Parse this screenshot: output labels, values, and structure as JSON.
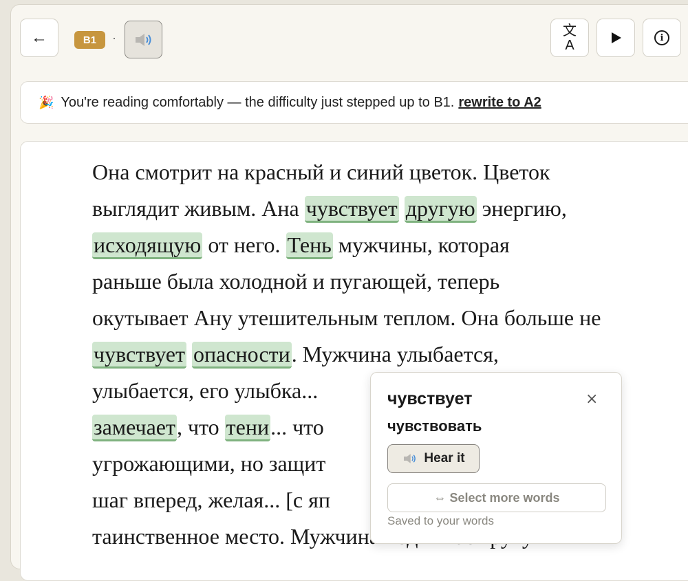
{
  "toolbar": {
    "back_label": "←",
    "level": "B1",
    "separator": "·",
    "translate_top": "文",
    "translate_bottom": "A",
    "play_label": "▶",
    "info_label": "i"
  },
  "notice": {
    "emoji": "🎉",
    "text": "You're reading comfortably — the difficulty just stepped up to B1.",
    "link": "rewrite to A2"
  },
  "reader": {
    "lines": [
      [
        {
          "t": "Она смотрит на красный и синий цветок. Цветок"
        }
      ],
      [
        {
          "t": "выглядит живым. Ана "
        },
        {
          "t": "чувствует",
          "h": true
        },
        {
          "t": " "
        },
        {
          "t": "другую",
          "h": true
        },
        {
          "t": " энергию,"
        }
      ],
      [
        {
          "t": "исходящую",
          "h": true
        },
        {
          "t": " от него. "
        },
        {
          "t": "Тень",
          "h": true
        },
        {
          "t": " мужчины, которая"
        }
      ],
      [
        {
          "t": "раньше была холодной и пугающей, теперь"
        }
      ],
      [
        {
          "t": "окутывает Ану утешительным теплом. Она больше не"
        }
      ],
      [
        {
          "t": "чувствует",
          "h": true
        },
        {
          "t": " "
        },
        {
          "t": "опасности",
          "h": true
        },
        {
          "t": ". Мужчина улыбается,"
        }
      ],
      [
        {
          "t": "улыбается, его улыбка... "
        }
      ],
      [
        {
          "t": "замечает",
          "h": true
        },
        {
          "t": ", что "
        },
        {
          "t": "тени",
          "h": true
        },
        {
          "t": "... что "
        }
      ],
      [
        {
          "t": "угрожающими, но защит"
        }
      ],
      [
        {
          "t": "шаг вперед, желая... [с яп"
        }
      ],
      [
        {
          "t": "таинственное место. Мужчина поднимает руку и"
        }
      ]
    ]
  },
  "popup": {
    "word": "чувствует",
    "lemma": "чувствовать",
    "close": "×",
    "hear": "Hear it",
    "select": "⇔ Select more words",
    "saved": "Saved to your words"
  }
}
